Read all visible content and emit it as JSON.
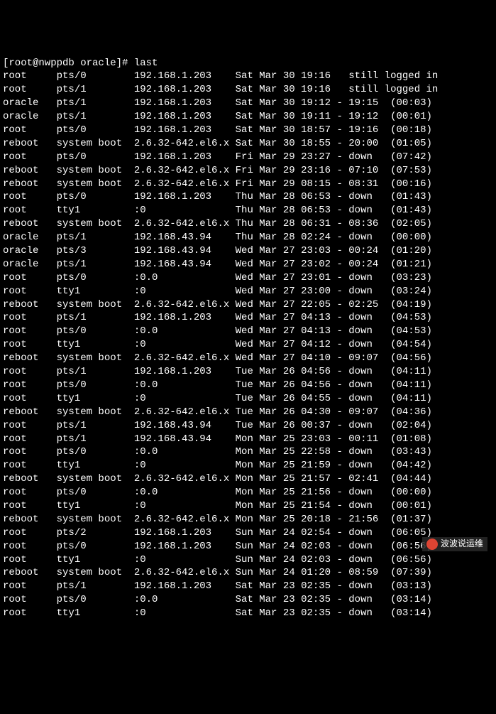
{
  "prompt": "[root@nwppdb oracle]# last",
  "rows": [
    {
      "user": "root",
      "tty": "pts/0",
      "from": "192.168.1.203",
      "login": "Sat Mar 30 19:16",
      "logout": "still logged in",
      "dur": ""
    },
    {
      "user": "root",
      "tty": "pts/1",
      "from": "192.168.1.203",
      "login": "Sat Mar 30 19:16",
      "logout": "still logged in",
      "dur": ""
    },
    {
      "user": "oracle",
      "tty": "pts/1",
      "from": "192.168.1.203",
      "login": "Sat Mar 30 19:12",
      "logout": "- 19:15",
      "dur": "(00:03)"
    },
    {
      "user": "oracle",
      "tty": "pts/1",
      "from": "192.168.1.203",
      "login": "Sat Mar 30 19:11",
      "logout": "- 19:12",
      "dur": "(00:01)"
    },
    {
      "user": "root",
      "tty": "pts/0",
      "from": "192.168.1.203",
      "login": "Sat Mar 30 18:57",
      "logout": "- 19:16",
      "dur": "(00:18)"
    },
    {
      "user": "reboot",
      "tty": "system boot",
      "from": "2.6.32-642.el6.x",
      "login": "Sat Mar 30 18:55",
      "logout": "- 20:00",
      "dur": "(01:05)"
    },
    {
      "user": "root",
      "tty": "pts/0",
      "from": "192.168.1.203",
      "login": "Fri Mar 29 23:27",
      "logout": "- down",
      "dur": "(07:42)"
    },
    {
      "user": "reboot",
      "tty": "system boot",
      "from": "2.6.32-642.el6.x",
      "login": "Fri Mar 29 23:16",
      "logout": "- 07:10",
      "dur": "(07:53)"
    },
    {
      "user": "reboot",
      "tty": "system boot",
      "from": "2.6.32-642.el6.x",
      "login": "Fri Mar 29 08:15",
      "logout": "- 08:31",
      "dur": "(00:16)"
    },
    {
      "user": "root",
      "tty": "pts/0",
      "from": "192.168.1.203",
      "login": "Thu Mar 28 06:53",
      "logout": "- down",
      "dur": "(01:43)"
    },
    {
      "user": "root",
      "tty": "tty1",
      "from": ":0",
      "login": "Thu Mar 28 06:53",
      "logout": "- down",
      "dur": "(01:43)"
    },
    {
      "user": "reboot",
      "tty": "system boot",
      "from": "2.6.32-642.el6.x",
      "login": "Thu Mar 28 06:31",
      "logout": "- 08:36",
      "dur": "(02:05)"
    },
    {
      "user": "oracle",
      "tty": "pts/1",
      "from": "192.168.43.94",
      "login": "Thu Mar 28 02:24",
      "logout": "- down",
      "dur": "(00:00)"
    },
    {
      "user": "oracle",
      "tty": "pts/3",
      "from": "192.168.43.94",
      "login": "Wed Mar 27 23:03",
      "logout": "- 00:24",
      "dur": "(01:20)"
    },
    {
      "user": "oracle",
      "tty": "pts/1",
      "from": "192.168.43.94",
      "login": "Wed Mar 27 23:02",
      "logout": "- 00:24",
      "dur": "(01:21)"
    },
    {
      "user": "root",
      "tty": "pts/0",
      "from": ":0.0",
      "login": "Wed Mar 27 23:01",
      "logout": "- down",
      "dur": "(03:23)"
    },
    {
      "user": "root",
      "tty": "tty1",
      "from": ":0",
      "login": "Wed Mar 27 23:00",
      "logout": "- down",
      "dur": "(03:24)"
    },
    {
      "user": "reboot",
      "tty": "system boot",
      "from": "2.6.32-642.el6.x",
      "login": "Wed Mar 27 22:05",
      "logout": "- 02:25",
      "dur": "(04:19)"
    },
    {
      "user": "root",
      "tty": "pts/1",
      "from": "192.168.1.203",
      "login": "Wed Mar 27 04:13",
      "logout": "- down",
      "dur": "(04:53)"
    },
    {
      "user": "root",
      "tty": "pts/0",
      "from": ":0.0",
      "login": "Wed Mar 27 04:13",
      "logout": "- down",
      "dur": "(04:53)"
    },
    {
      "user": "root",
      "tty": "tty1",
      "from": ":0",
      "login": "Wed Mar 27 04:12",
      "logout": "- down",
      "dur": "(04:54)"
    },
    {
      "user": "reboot",
      "tty": "system boot",
      "from": "2.6.32-642.el6.x",
      "login": "Wed Mar 27 04:10",
      "logout": "- 09:07",
      "dur": "(04:56)"
    },
    {
      "user": "root",
      "tty": "pts/1",
      "from": "192.168.1.203",
      "login": "Tue Mar 26 04:56",
      "logout": "- down",
      "dur": "(04:11)"
    },
    {
      "user": "root",
      "tty": "pts/0",
      "from": ":0.0",
      "login": "Tue Mar 26 04:56",
      "logout": "- down",
      "dur": "(04:11)"
    },
    {
      "user": "root",
      "tty": "tty1",
      "from": ":0",
      "login": "Tue Mar 26 04:55",
      "logout": "- down",
      "dur": "(04:11)"
    },
    {
      "user": "reboot",
      "tty": "system boot",
      "from": "2.6.32-642.el6.x",
      "login": "Tue Mar 26 04:30",
      "logout": "- 09:07",
      "dur": "(04:36)"
    },
    {
      "user": "root",
      "tty": "pts/1",
      "from": "192.168.43.94",
      "login": "Tue Mar 26 00:37",
      "logout": "- down",
      "dur": "(02:04)"
    },
    {
      "user": "root",
      "tty": "pts/1",
      "from": "192.168.43.94",
      "login": "Mon Mar 25 23:03",
      "logout": "- 00:11",
      "dur": "(01:08)"
    },
    {
      "user": "root",
      "tty": "pts/0",
      "from": ":0.0",
      "login": "Mon Mar 25 22:58",
      "logout": "- down",
      "dur": "(03:43)"
    },
    {
      "user": "root",
      "tty": "tty1",
      "from": ":0",
      "login": "Mon Mar 25 21:59",
      "logout": "- down",
      "dur": "(04:42)"
    },
    {
      "user": "reboot",
      "tty": "system boot",
      "from": "2.6.32-642.el6.x",
      "login": "Mon Mar 25 21:57",
      "logout": "- 02:41",
      "dur": "(04:44)"
    },
    {
      "user": "root",
      "tty": "pts/0",
      "from": ":0.0",
      "login": "Mon Mar 25 21:56",
      "logout": "- down",
      "dur": "(00:00)"
    },
    {
      "user": "root",
      "tty": "tty1",
      "from": ":0",
      "login": "Mon Mar 25 21:54",
      "logout": "- down",
      "dur": "(00:01)"
    },
    {
      "user": "reboot",
      "tty": "system boot",
      "from": "2.6.32-642.el6.x",
      "login": "Mon Mar 25 20:18",
      "logout": "- 21:56",
      "dur": "(01:37)"
    },
    {
      "user": "root",
      "tty": "pts/2",
      "from": "192.168.1.203",
      "login": "Sun Mar 24 02:54",
      "logout": "- down",
      "dur": "(06:05)"
    },
    {
      "user": "root",
      "tty": "pts/0",
      "from": "192.168.1.203",
      "login": "Sun Mar 24 02:03",
      "logout": "- down",
      "dur": "(06:56)"
    },
    {
      "user": "root",
      "tty": "tty1",
      "from": ":0",
      "login": "Sun Mar 24 02:03",
      "logout": "- down",
      "dur": "(06:56)"
    },
    {
      "user": "reboot",
      "tty": "system boot",
      "from": "2.6.32-642.el6.x",
      "login": "Sun Mar 24 01:20",
      "logout": "- 08:59",
      "dur": "(07:39)"
    },
    {
      "user": "root",
      "tty": "pts/1",
      "from": "192.168.1.203",
      "login": "Sat Mar 23 02:35",
      "logout": "- down",
      "dur": "(03:13)"
    },
    {
      "user": "root",
      "tty": "pts/0",
      "from": ":0.0",
      "login": "Sat Mar 23 02:35",
      "logout": "- down",
      "dur": "(03:14)"
    },
    {
      "user": "root",
      "tty": "tty1",
      "from": ":0",
      "login": "Sat Mar 23 02:35",
      "logout": "- down",
      "dur": "(03:14)"
    }
  ],
  "watermark": "波波说运维"
}
